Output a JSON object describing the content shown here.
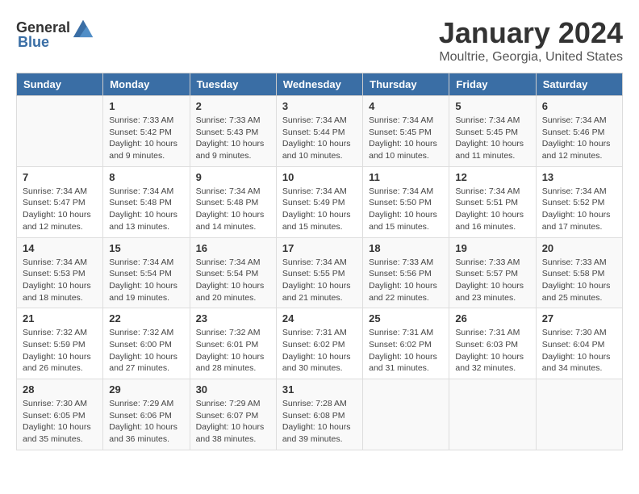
{
  "logo": {
    "general": "General",
    "blue": "Blue"
  },
  "title": "January 2024",
  "location": "Moultrie, Georgia, United States",
  "days_of_week": [
    "Sunday",
    "Monday",
    "Tuesday",
    "Wednesday",
    "Thursday",
    "Friday",
    "Saturday"
  ],
  "weeks": [
    [
      {
        "day": "",
        "info": ""
      },
      {
        "day": "1",
        "info": "Sunrise: 7:33 AM\nSunset: 5:42 PM\nDaylight: 10 hours\nand 9 minutes."
      },
      {
        "day": "2",
        "info": "Sunrise: 7:33 AM\nSunset: 5:43 PM\nDaylight: 10 hours\nand 9 minutes."
      },
      {
        "day": "3",
        "info": "Sunrise: 7:34 AM\nSunset: 5:44 PM\nDaylight: 10 hours\nand 10 minutes."
      },
      {
        "day": "4",
        "info": "Sunrise: 7:34 AM\nSunset: 5:45 PM\nDaylight: 10 hours\nand 10 minutes."
      },
      {
        "day": "5",
        "info": "Sunrise: 7:34 AM\nSunset: 5:45 PM\nDaylight: 10 hours\nand 11 minutes."
      },
      {
        "day": "6",
        "info": "Sunrise: 7:34 AM\nSunset: 5:46 PM\nDaylight: 10 hours\nand 12 minutes."
      }
    ],
    [
      {
        "day": "7",
        "info": "Sunrise: 7:34 AM\nSunset: 5:47 PM\nDaylight: 10 hours\nand 12 minutes."
      },
      {
        "day": "8",
        "info": "Sunrise: 7:34 AM\nSunset: 5:48 PM\nDaylight: 10 hours\nand 13 minutes."
      },
      {
        "day": "9",
        "info": "Sunrise: 7:34 AM\nSunset: 5:48 PM\nDaylight: 10 hours\nand 14 minutes."
      },
      {
        "day": "10",
        "info": "Sunrise: 7:34 AM\nSunset: 5:49 PM\nDaylight: 10 hours\nand 15 minutes."
      },
      {
        "day": "11",
        "info": "Sunrise: 7:34 AM\nSunset: 5:50 PM\nDaylight: 10 hours\nand 15 minutes."
      },
      {
        "day": "12",
        "info": "Sunrise: 7:34 AM\nSunset: 5:51 PM\nDaylight: 10 hours\nand 16 minutes."
      },
      {
        "day": "13",
        "info": "Sunrise: 7:34 AM\nSunset: 5:52 PM\nDaylight: 10 hours\nand 17 minutes."
      }
    ],
    [
      {
        "day": "14",
        "info": "Sunrise: 7:34 AM\nSunset: 5:53 PM\nDaylight: 10 hours\nand 18 minutes."
      },
      {
        "day": "15",
        "info": "Sunrise: 7:34 AM\nSunset: 5:54 PM\nDaylight: 10 hours\nand 19 minutes."
      },
      {
        "day": "16",
        "info": "Sunrise: 7:34 AM\nSunset: 5:54 PM\nDaylight: 10 hours\nand 20 minutes."
      },
      {
        "day": "17",
        "info": "Sunrise: 7:34 AM\nSunset: 5:55 PM\nDaylight: 10 hours\nand 21 minutes."
      },
      {
        "day": "18",
        "info": "Sunrise: 7:33 AM\nSunset: 5:56 PM\nDaylight: 10 hours\nand 22 minutes."
      },
      {
        "day": "19",
        "info": "Sunrise: 7:33 AM\nSunset: 5:57 PM\nDaylight: 10 hours\nand 23 minutes."
      },
      {
        "day": "20",
        "info": "Sunrise: 7:33 AM\nSunset: 5:58 PM\nDaylight: 10 hours\nand 25 minutes."
      }
    ],
    [
      {
        "day": "21",
        "info": "Sunrise: 7:32 AM\nSunset: 5:59 PM\nDaylight: 10 hours\nand 26 minutes."
      },
      {
        "day": "22",
        "info": "Sunrise: 7:32 AM\nSunset: 6:00 PM\nDaylight: 10 hours\nand 27 minutes."
      },
      {
        "day": "23",
        "info": "Sunrise: 7:32 AM\nSunset: 6:01 PM\nDaylight: 10 hours\nand 28 minutes."
      },
      {
        "day": "24",
        "info": "Sunrise: 7:31 AM\nSunset: 6:02 PM\nDaylight: 10 hours\nand 30 minutes."
      },
      {
        "day": "25",
        "info": "Sunrise: 7:31 AM\nSunset: 6:02 PM\nDaylight: 10 hours\nand 31 minutes."
      },
      {
        "day": "26",
        "info": "Sunrise: 7:31 AM\nSunset: 6:03 PM\nDaylight: 10 hours\nand 32 minutes."
      },
      {
        "day": "27",
        "info": "Sunrise: 7:30 AM\nSunset: 6:04 PM\nDaylight: 10 hours\nand 34 minutes."
      }
    ],
    [
      {
        "day": "28",
        "info": "Sunrise: 7:30 AM\nSunset: 6:05 PM\nDaylight: 10 hours\nand 35 minutes."
      },
      {
        "day": "29",
        "info": "Sunrise: 7:29 AM\nSunset: 6:06 PM\nDaylight: 10 hours\nand 36 minutes."
      },
      {
        "day": "30",
        "info": "Sunrise: 7:29 AM\nSunset: 6:07 PM\nDaylight: 10 hours\nand 38 minutes."
      },
      {
        "day": "31",
        "info": "Sunrise: 7:28 AM\nSunset: 6:08 PM\nDaylight: 10 hours\nand 39 minutes."
      },
      {
        "day": "",
        "info": ""
      },
      {
        "day": "",
        "info": ""
      },
      {
        "day": "",
        "info": ""
      }
    ]
  ]
}
